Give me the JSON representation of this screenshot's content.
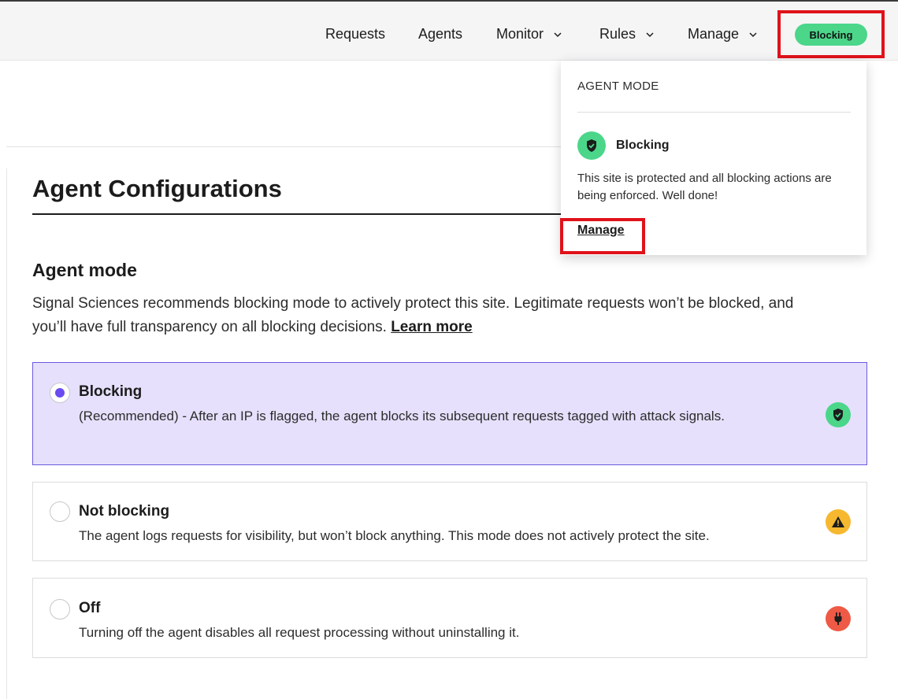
{
  "nav": {
    "items": [
      {
        "label": "Requests",
        "has_menu": false
      },
      {
        "label": "Agents",
        "has_menu": false
      },
      {
        "label": "Monitor",
        "has_menu": true
      },
      {
        "label": "Rules",
        "has_menu": true
      },
      {
        "label": "Manage",
        "has_menu": true
      }
    ],
    "mode_badge": "Blocking"
  },
  "popover": {
    "heading": "AGENT MODE",
    "mode": "Blocking",
    "description": "This site is protected and all blocking actions are being enforced. Well done!",
    "link": "Manage"
  },
  "page": {
    "title": "Agent Configurations"
  },
  "agent_mode": {
    "title": "Agent mode",
    "description": "Signal Sciences recommends blocking mode to actively protect this site. Legitimate requests won’t be blocked, and you’ll have full transparency on all blocking decisions.",
    "learn_more": "Learn more",
    "options": [
      {
        "title": "Blocking",
        "description": "(Recommended) - After an IP is flagged, the agent blocks its subsequent requests tagged with attack signals.",
        "selected": true,
        "icon": "shield-check-icon"
      },
      {
        "title": "Not blocking",
        "description": "The agent logs requests for visibility, but won’t block anything. This mode does not actively protect the site.",
        "selected": false,
        "icon": "warning-icon"
      },
      {
        "title": "Off",
        "description": "Turning off the agent disables all request processing without uninstalling it.",
        "selected": false,
        "icon": "plug-icon"
      }
    ]
  },
  "colors": {
    "accent": "#6a4cf0",
    "selected_bg": "#e6e0fc",
    "blocking_green": "#4bd68a",
    "warning_yellow": "#f5b82e",
    "off_red": "#ee5a45",
    "highlight_red": "#e0121a"
  }
}
